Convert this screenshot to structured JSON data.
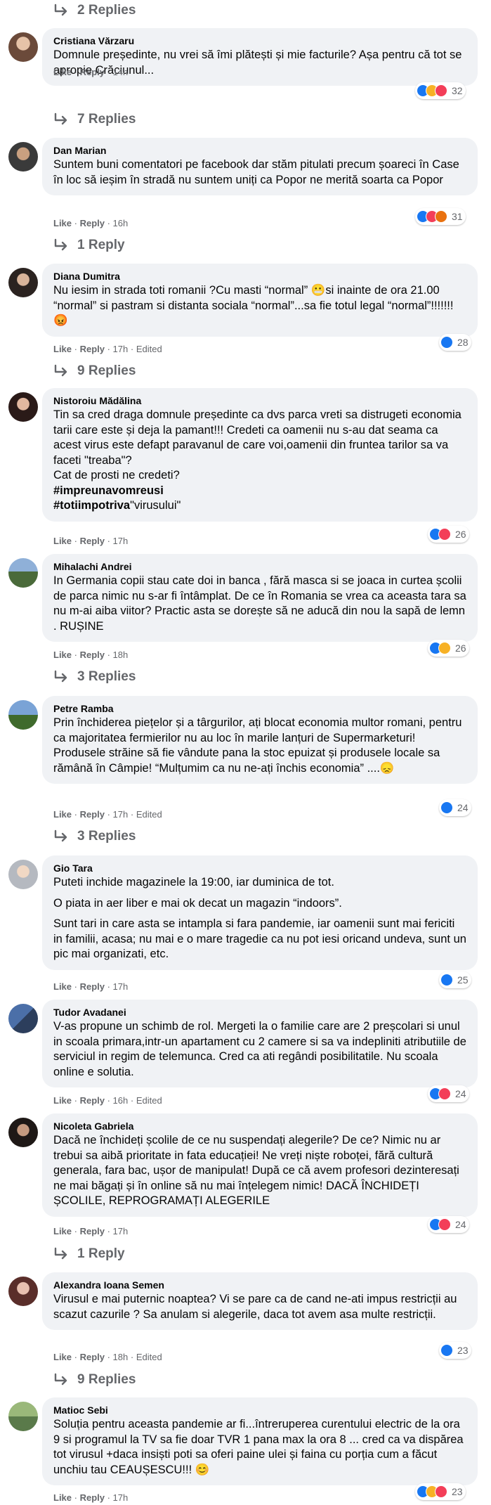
{
  "replies_top": "2 Replies",
  "meta_labels": {
    "like": "Like",
    "reply": "Reply"
  },
  "comments": [
    {
      "author": "Cristiana Vărzaru",
      "lines": [
        "Domnule președinte, nu vrei să îmi plătești și mie facturile? Așa pentru că tot se apropie Crăciunul..."
      ],
      "time": "14h",
      "edited": "",
      "reactions": [
        "like",
        "haha",
        "love"
      ],
      "reaction_count": "32",
      "replies": "7 Replies"
    },
    {
      "author": "Dan Marian",
      "lines": [
        "Suntem buni comentatori pe facebook dar stăm pitulati precum șoareci în Case în loc să ieșim în stradă nu suntem uniți ca Popor ne merită soarta ca Popor"
      ],
      "time": "16h",
      "edited": "",
      "reactions": [
        "like",
        "love",
        "angry"
      ],
      "reaction_count": "31",
      "replies": "1 Reply"
    },
    {
      "author": "Diana Dumitra",
      "lines": [
        "Nu iesim in strada toti romanii ?Cu masti “normal” 😬si inainte de ora 21.00 “normal” si pastram si distanta sociala “normal”...sa fie totul legal “normal”!!!!!!! 😡"
      ],
      "time": "17h",
      "edited": "Edited",
      "reactions": [
        "like"
      ],
      "reaction_count": "28",
      "replies": "9 Replies"
    },
    {
      "author": "Nistoroiu Mădălina",
      "lines": [
        "Tin sa cred draga domnule președinte ca dvs parca vreti sa distrugeti economia tarii care este și deja la pamant!!! Credeti ca oamenii nu s-au dat seama ca acest virus este defapt paravanul de care voi,oamenii din fruntea tarilor sa va faceti \"treaba\"?",
        "Cat de prosti ne credeti?"
      ],
      "hashtag1": "#impreunavomreusi",
      "hashtag2": "#totiimpotriva",
      "hashtag2_rest": "\"virusului\"",
      "time": "17h",
      "edited": "",
      "reactions": [
        "like",
        "love"
      ],
      "reaction_count": "26",
      "replies": ""
    },
    {
      "author": "Mihalachi Andrei",
      "lines": [
        "In Germania copii stau cate doi in banca , fără masca si se joaca in curtea școlii de parca nimic nu s-ar fi întâmplat. De ce în Romania se vrea ca aceasta tara sa nu m-ai aiba viitor? Practic asta se dorește să ne aducă din nou la sapă de lemn . RUȘINE"
      ],
      "time": "18h",
      "edited": "",
      "reactions": [
        "like",
        "sad"
      ],
      "reaction_count": "26",
      "replies": "3 Replies"
    },
    {
      "author": "Petre Ramba",
      "lines": [
        "Prin închiderea piețelor și a târgurilor, ați blocat economia multor romani, pentru ca majoritatea fermierilor nu au loc în marile lanțuri de Supermarketuri! Produsele străine să fie vândute pana la stoc epuizat și produsele locale sa rămână în Câmpie! “Mulțumim ca nu ne-ați închis economia” ....😞"
      ],
      "time": "17h",
      "edited": "Edited",
      "reactions": [
        "like"
      ],
      "reaction_count": "24",
      "replies": "3 Replies"
    },
    {
      "author": "Gio Tara",
      "lines": [
        "Puteti inchide magazinele la 19:00, iar duminica de tot.",
        "O piata in aer liber e mai ok decat un magazin “indoors”.",
        "Sunt tari in care asta se intampla si fara pandemie, iar oamenii sunt mai fericiti in familii, acasa; nu mai e o mare tragedie ca nu pot iesi oricand undeva, sunt un pic mai organizati, etc."
      ],
      "time": "17h",
      "edited": "",
      "reactions": [
        "like"
      ],
      "reaction_count": "25",
      "replies": ""
    },
    {
      "author": "Tudor Avadanei",
      "lines": [
        "V-as propune un schimb de rol. Mergeti la o familie care are 2 preșcolari si unul in scoala primara,intr-un apartament cu 2 camere si sa va indepliniti atributiile de serviciul in regim de telemunca. Cred ca ati regândi posibilitatile. Nu scoala online e solutia."
      ],
      "time": "16h",
      "edited": "Edited",
      "reactions": [
        "like",
        "love"
      ],
      "reaction_count": "24",
      "replies": ""
    },
    {
      "author": "Nicoleta Gabriela",
      "lines": [
        "Dacă ne închideți școlile de ce nu suspendați alegerile? De ce? Nimic nu ar trebui sa aibă prioritate in fata educației! Ne vreți niște roboței, fără cultură generala, fara bac, ușor de manipulat! După ce că avem profesori dezinteresați ne mai băgați și în online să nu mai înțelegem nimic! DACĂ ÎNCHIDEȚI ȘCOLILE, REPROGRAMAȚI ALEGERILE"
      ],
      "time": "17h",
      "edited": "",
      "reactions": [
        "like",
        "love"
      ],
      "reaction_count": "24",
      "replies": "1 Reply"
    },
    {
      "author": "Alexandra Ioana Semen",
      "lines": [
        "Virusul e mai puternic noaptea? Vi se pare ca de cand ne-ati impus restricții au scazut cazurile ? Sa anulam si alegerile, daca tot avem asa multe restricții."
      ],
      "time": "18h",
      "edited": "Edited",
      "reactions": [
        "like"
      ],
      "reaction_count": "23",
      "replies": "9 Replies"
    },
    {
      "author": "Matioc Sebi",
      "lines": [
        "Soluția pentru aceasta pandemie ar fi...întreruperea curentului electric de la ora 9 si programul la TV sa fie doar TVR 1 pana max la ora 8 ... cred ca va dispărea tot virusul +daca insiști poti sa oferi paine ulei și faina cu porția cum a făcut unchiu tau CEAUȘESCU!!! 😊"
      ],
      "time": "17h",
      "edited": "",
      "reactions": [
        "like",
        "haha",
        "love"
      ],
      "reaction_count": "23",
      "replies": ""
    }
  ]
}
